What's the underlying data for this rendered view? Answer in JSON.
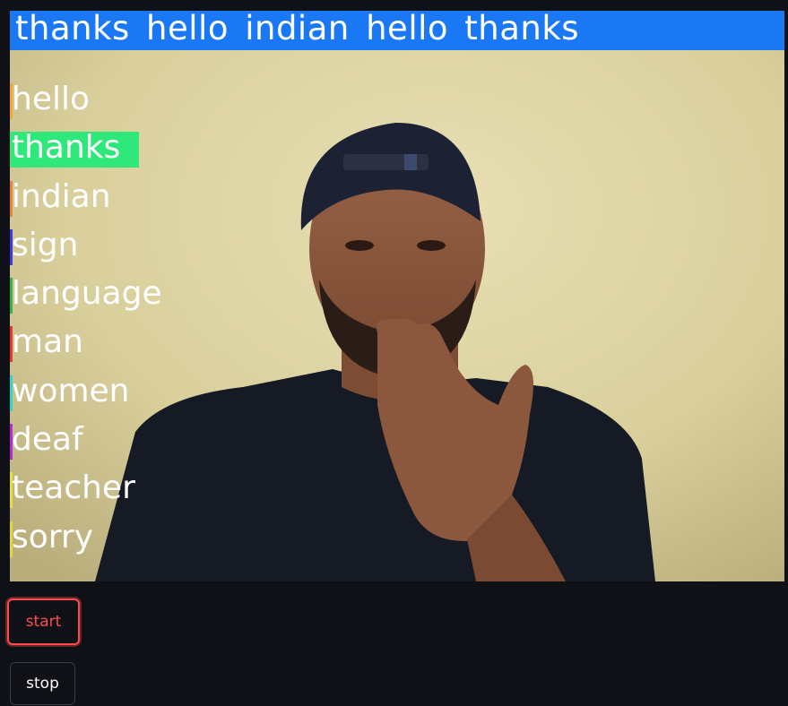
{
  "video": {
    "sentence": "thanks hello indian hello thanks",
    "sentence_bar_color": "#1a78f5"
  },
  "probabilities": [
    {
      "label": "hello",
      "color": "#f5a623",
      "value": 0.0
    },
    {
      "label": "thanks",
      "color": "#2ee87a",
      "value": 0.48
    },
    {
      "label": "indian",
      "color": "#e8842e",
      "value": 0.0
    },
    {
      "label": "sign",
      "color": "#3b3bd6",
      "value": 0.0
    },
    {
      "label": "language",
      "color": "#2fb83a",
      "value": 0.0
    },
    {
      "label": "man",
      "color": "#e03a2e",
      "value": 0.0
    },
    {
      "label": "women",
      "color": "#2ed6c9",
      "value": 0.0
    },
    {
      "label": "deaf",
      "color": "#b02ed6",
      "value": 0.0
    },
    {
      "label": "teacher",
      "color": "#e8e02e",
      "value": 0.0
    },
    {
      "label": "sorry",
      "color": "#e8d62e",
      "value": 0.0
    }
  ],
  "controls": {
    "start_label": "start",
    "stop_label": "stop",
    "start_color": "#ff4b4b"
  }
}
